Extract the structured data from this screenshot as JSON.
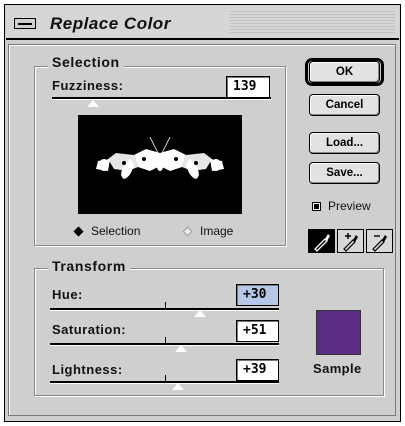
{
  "window": {
    "title": "Replace Color"
  },
  "selection": {
    "group_label": "Selection",
    "fuzziness_label": "Fuzziness:",
    "fuzziness_value": "139",
    "radio_selection": "Selection",
    "radio_image": "Image",
    "selected_mode": "Selection"
  },
  "buttons": {
    "ok": "OK",
    "cancel": "Cancel",
    "load": "Load...",
    "save": "Save..."
  },
  "preview": {
    "label": "Preview",
    "checked": true
  },
  "tools": [
    "eyedropper-icon",
    "eyedropper-plus-icon",
    "eyedropper-minus-icon"
  ],
  "transform": {
    "group_label": "Transform",
    "hue_label": "Hue:",
    "hue_value": "+30",
    "saturation_label": "Saturation:",
    "saturation_value": "+51",
    "lightness_label": "Lightness:",
    "lightness_value": "+39",
    "sample_label": "Sample",
    "sample_color": "#5a2c82"
  }
}
